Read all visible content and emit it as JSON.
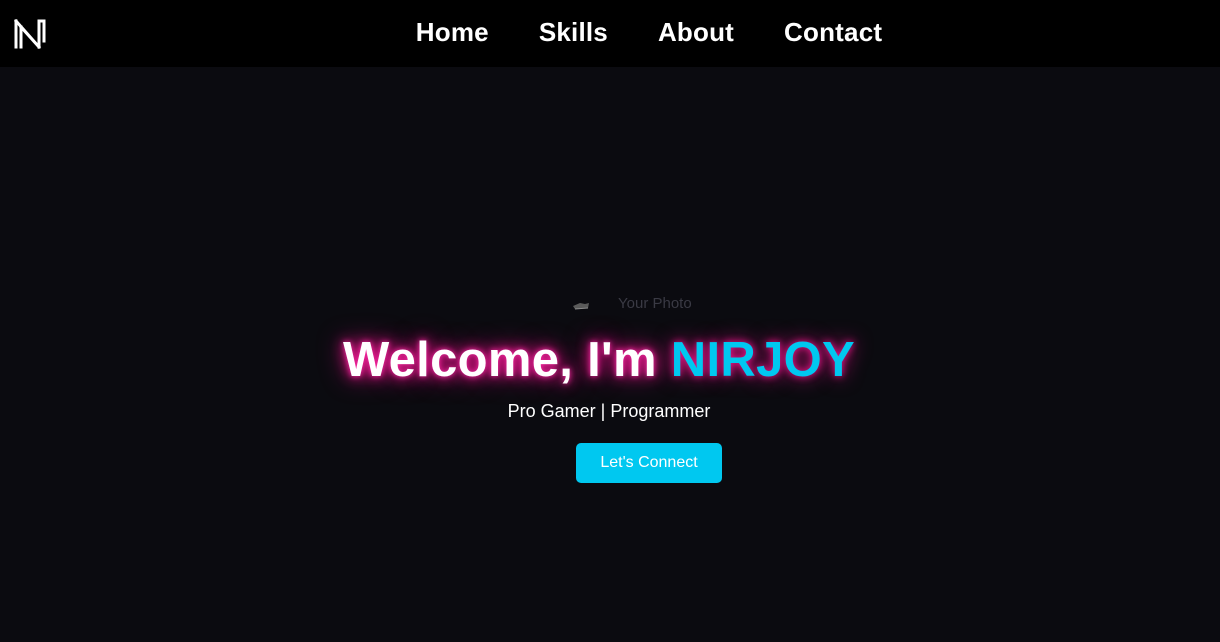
{
  "nav": {
    "logo_icon": "n-logo-icon",
    "links": [
      {
        "label": "Home"
      },
      {
        "label": "Skills"
      },
      {
        "label": "About"
      },
      {
        "label": "Contact"
      }
    ]
  },
  "hero": {
    "photo_alt": "Your Photo",
    "photo_icon": "broken-image-icon",
    "welcome_text": "Welcome, I'm ",
    "name": "NIRJOY",
    "tagline": "Pro Gamer | Programmer",
    "cta_label": "Let's Connect"
  },
  "colors": {
    "background": "#0b0b10",
    "navbar": "#000000",
    "accent": "#00c8f0",
    "glow": "#ff1493"
  }
}
